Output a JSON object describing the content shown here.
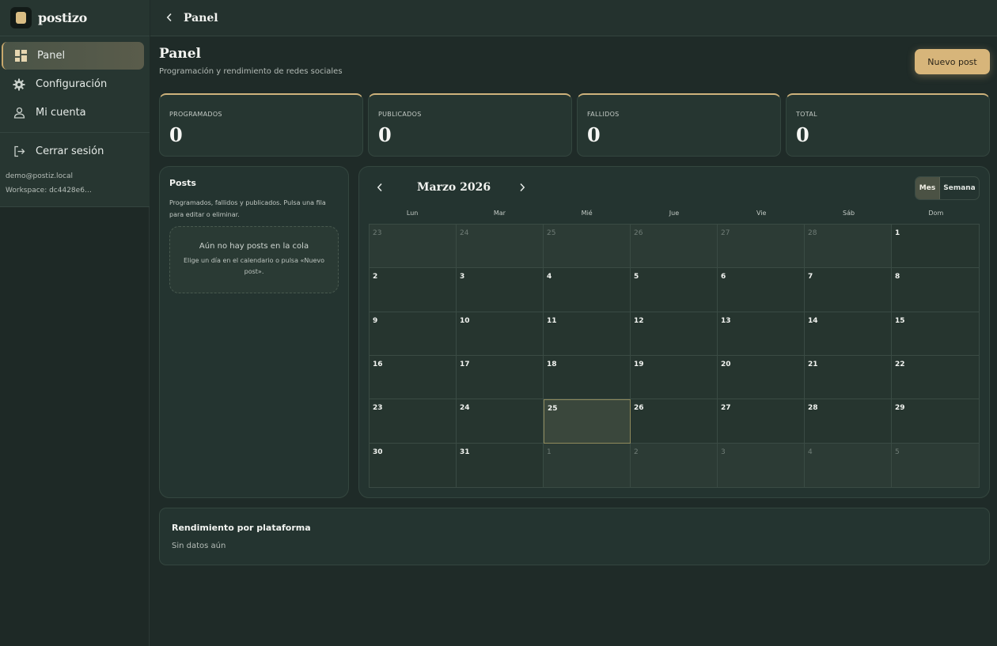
{
  "app": {
    "name": "postizo"
  },
  "sidebar": {
    "items": [
      {
        "label": "Panel",
        "icon": "dashboard-icon",
        "active": true
      },
      {
        "label": "Configuración",
        "icon": "gear-icon"
      },
      {
        "label": "Mi cuenta",
        "icon": "user-icon"
      }
    ],
    "logout_label": "Cerrar sesión",
    "user_email": "demo@postiz.local",
    "workspace": "Workspace: dc4428e6…"
  },
  "topbar": {
    "title": "Panel"
  },
  "page": {
    "title": "Panel",
    "subtitle": "Programación y rendimiento de redes sociales",
    "new_post_label": "Nuevo post"
  },
  "stats": [
    {
      "label": "PROGRAMADOS",
      "value": "0"
    },
    {
      "label": "PUBLICADOS",
      "value": "0"
    },
    {
      "label": "FALLIDOS",
      "value": "0"
    },
    {
      "label": "TOTAL",
      "value": "0"
    }
  ],
  "posts": {
    "title": "Posts",
    "description": "Programados, fallidos y publicados. Pulsa una fila para editar o eliminar.",
    "empty_title": "Aún no hay posts en la cola",
    "empty_description": "Elige un día en el calendario o pulsa «Nuevo post»."
  },
  "calendar": {
    "month_label": "Marzo 2026",
    "view_month": "Mes",
    "view_week": "Semana",
    "weekdays": [
      "Lun",
      "Mar",
      "Mié",
      "Jue",
      "Vie",
      "Sáb",
      "Dom"
    ],
    "days": [
      {
        "d": "23",
        "other": true
      },
      {
        "d": "24",
        "other": true
      },
      {
        "d": "25",
        "other": true
      },
      {
        "d": "26",
        "other": true
      },
      {
        "d": "27",
        "other": true
      },
      {
        "d": "28",
        "other": true
      },
      {
        "d": "1"
      },
      {
        "d": "2"
      },
      {
        "d": "3"
      },
      {
        "d": "4"
      },
      {
        "d": "5"
      },
      {
        "d": "6"
      },
      {
        "d": "7"
      },
      {
        "d": "8"
      },
      {
        "d": "9"
      },
      {
        "d": "10"
      },
      {
        "d": "11"
      },
      {
        "d": "12"
      },
      {
        "d": "13"
      },
      {
        "d": "14"
      },
      {
        "d": "15"
      },
      {
        "d": "16"
      },
      {
        "d": "17"
      },
      {
        "d": "18"
      },
      {
        "d": "19"
      },
      {
        "d": "20"
      },
      {
        "d": "21"
      },
      {
        "d": "22"
      },
      {
        "d": "23"
      },
      {
        "d": "24"
      },
      {
        "d": "25",
        "today": true
      },
      {
        "d": "26"
      },
      {
        "d": "27"
      },
      {
        "d": "28"
      },
      {
        "d": "29"
      },
      {
        "d": "30"
      },
      {
        "d": "31"
      },
      {
        "d": "1",
        "other": true
      },
      {
        "d": "2",
        "other": true
      },
      {
        "d": "3",
        "other": true
      },
      {
        "d": "4",
        "other": true
      },
      {
        "d": "5",
        "other": true
      }
    ]
  },
  "performance": {
    "title": "Rendimiento por plataforma",
    "empty": "Sin datos aún"
  },
  "colors": {
    "accent": "#d7b57a",
    "background": "#1f2b28"
  }
}
